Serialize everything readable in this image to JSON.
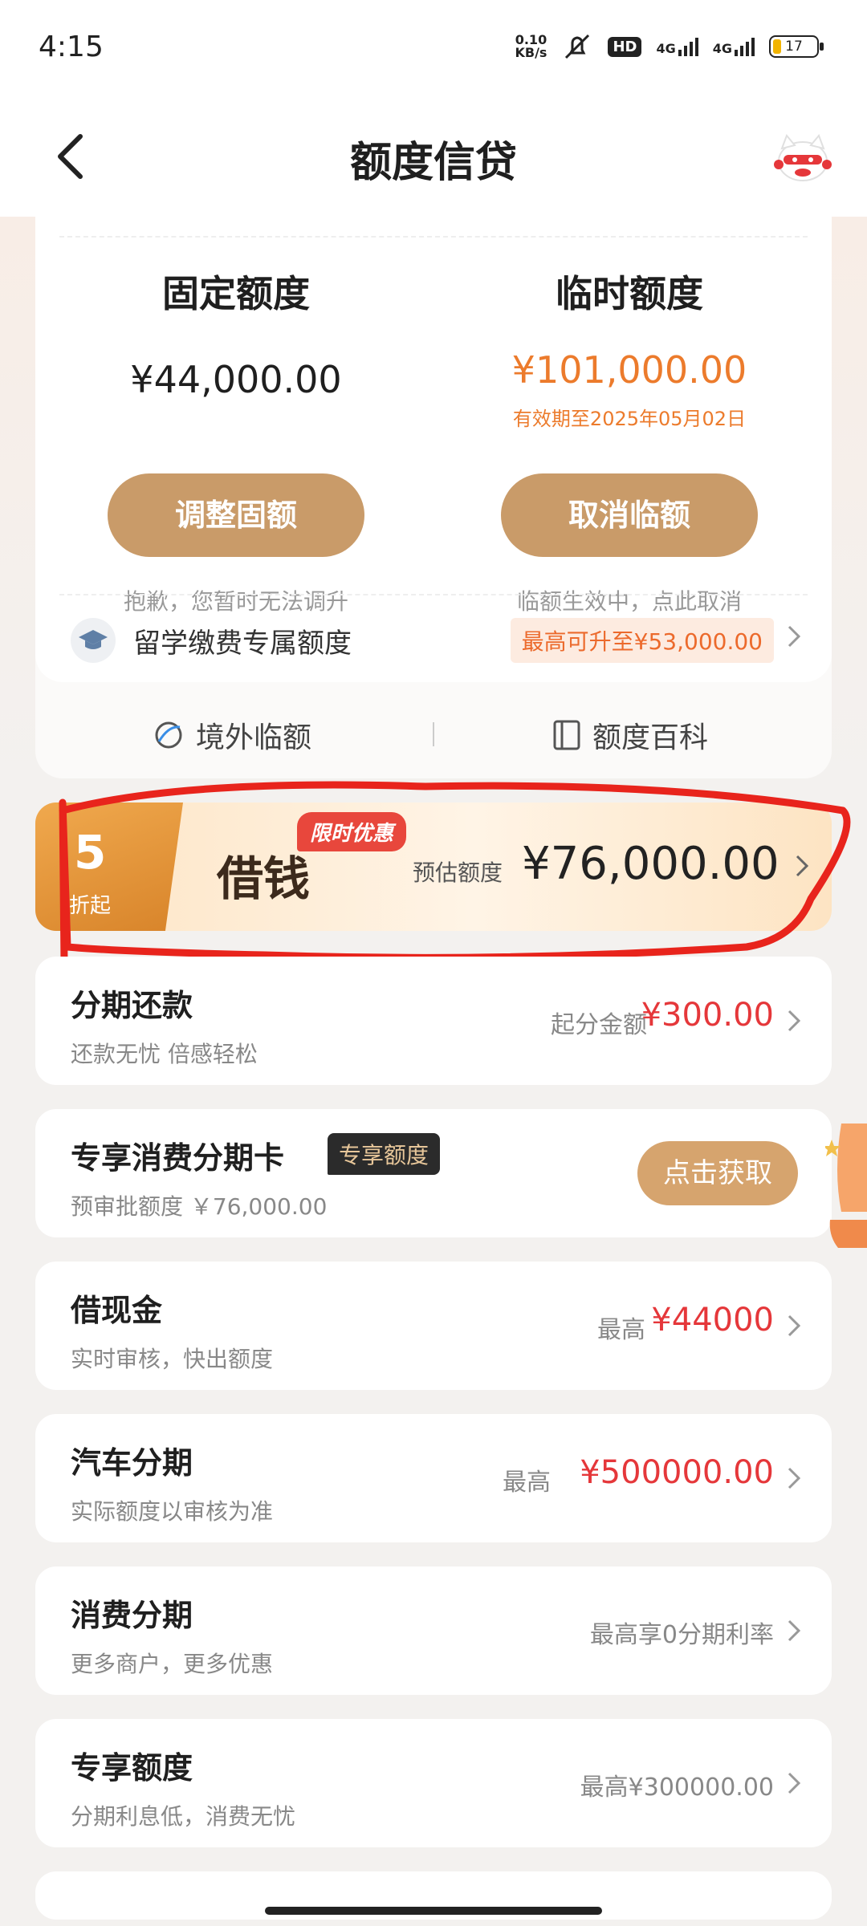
{
  "status_bar": {
    "time": "4:15",
    "net_speed_value": "0.10",
    "net_speed_unit": "KB/s",
    "hd_label": "HD",
    "signal_label_1": "4G",
    "signal_label_2": "4G",
    "battery": "17"
  },
  "nav": {
    "title": "额度信贷"
  },
  "limits": {
    "fixed": {
      "title": "固定额度",
      "amount": "¥44,000.00",
      "button": "调整固额",
      "note": "抱歉，您暂时无法调升"
    },
    "temporary": {
      "title": "临时额度",
      "amount": "¥101,000.00",
      "valid": "有效期至2025年05月02日",
      "button": "取消临额",
      "note": "临额生效中，点此取消"
    },
    "study": {
      "label": "留学缴费专属额度",
      "tag": "最高可升至¥53,000.00"
    },
    "links": [
      {
        "label": "境外临额"
      },
      {
        "label": "额度百科"
      }
    ]
  },
  "borrow_banner": {
    "discount_number": "5",
    "discount_text": "折起",
    "title": "借钱",
    "badge": "限时优惠",
    "estimate_label": "预估额度",
    "estimate_value": "¥76,000.00"
  },
  "items": [
    {
      "title": "分期还款",
      "subtitle": "还款无忧 倍感轻松",
      "right_label": "起分金额",
      "right_value": "¥300.00"
    },
    {
      "title": "专享消费分期卡",
      "tag": "专享额度",
      "subtitle": "预审批额度 ￥76,000.00",
      "button": "点击获取"
    },
    {
      "title": "借现金",
      "subtitle": "实时审核，快出额度",
      "right_label": "最高",
      "right_value": "¥44000"
    },
    {
      "title": "汽车分期",
      "subtitle": "实际额度以审核为准",
      "right_label": "最高",
      "right_value": "¥500000.00"
    },
    {
      "title": "消费分期",
      "subtitle": "更多商户，更多优惠",
      "right_label": "最高享0分期利率"
    },
    {
      "title": "专享额度",
      "subtitle": "分期利息低，消费无忧",
      "right_label": "最高¥300000.00"
    }
  ],
  "colors": {
    "accent_gold": "#c99b69",
    "orange": "#ec7b2c",
    "red": "#e5373a",
    "annotation_red": "#e8241c"
  }
}
